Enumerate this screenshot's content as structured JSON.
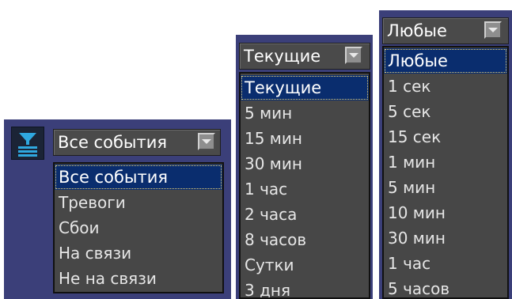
{
  "event_filter": {
    "selected": "Все события",
    "options": [
      "Все события",
      "Тревоги",
      "Сбои",
      "На связи",
      "Не на связи"
    ]
  },
  "period_filter": {
    "selected": "Текущие",
    "options": [
      "Текущие",
      "5 мин",
      "15 мин",
      "30 мин",
      "1 час",
      "2 часа",
      "8 часов",
      "Сутки",
      "3 дня"
    ]
  },
  "duration_filter": {
    "selected": "Любые",
    "options": [
      "Любые",
      "1 сек",
      "5 сек",
      "15 сек",
      "1 мин",
      "5 мин",
      "10 мин",
      "30 мин",
      "1 час",
      "5 часов"
    ]
  },
  "colors": {
    "panel": "#3b3f79",
    "list_bg": "#474747",
    "selection": "#0a2d6e",
    "filter_icon": "#2fa8e0"
  },
  "icons": {
    "filter": "filter-funnel-icon",
    "dropdown": "chevron-down-icon"
  }
}
